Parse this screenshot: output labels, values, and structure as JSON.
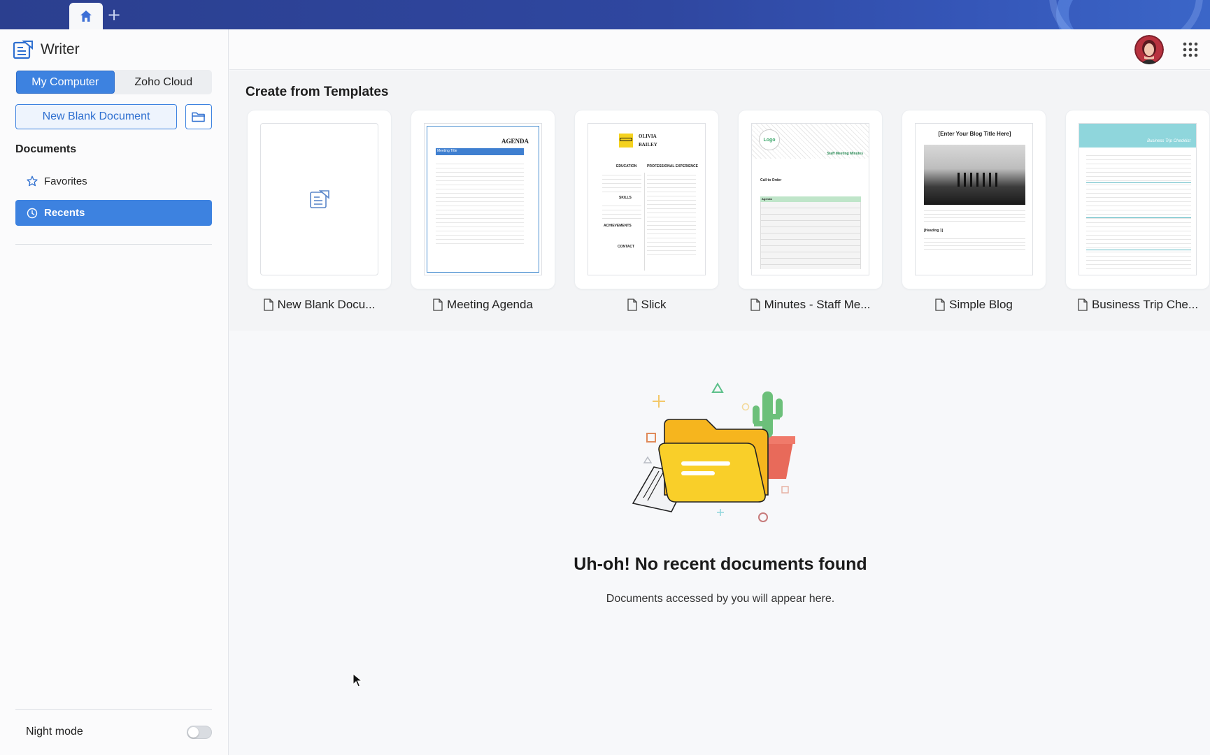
{
  "app": {
    "name": "Writer"
  },
  "tabs": [
    {
      "icon": "home-icon"
    },
    {
      "icon": "plus-icon"
    }
  ],
  "sidebar": {
    "source_tabs": [
      "My Computer",
      "Zoho Cloud"
    ],
    "active_source": "My Computer",
    "new_blank_label": "New Blank Document",
    "section_title": "Documents",
    "nav": [
      {
        "label": "Favorites",
        "icon": "star-icon",
        "active": false
      },
      {
        "label": "Recents",
        "icon": "clock-icon",
        "active": true
      }
    ],
    "night_mode_label": "Night mode",
    "night_mode_on": false
  },
  "templates": {
    "title": "Create from Templates",
    "items": [
      {
        "label": "New Blank Docu..."
      },
      {
        "label": "Meeting Agenda",
        "preview_heading": "AGENDA",
        "preview_bar": "Meeting Title"
      },
      {
        "label": "Slick",
        "preview_name": "OLIVIA BAILEY",
        "preview_sections": [
          "EDUCATION",
          "PROFESSIONAL EXPERIENCE",
          "SKILLS",
          "ACHIEVEMENTS",
          "CONTACT"
        ]
      },
      {
        "label": "Minutes - Staff Me...",
        "preview_logo": "Logo",
        "preview_heading": "Staff Meeting Minutes",
        "preview_sub": "Call to Order",
        "preview_col": "Agenda"
      },
      {
        "label": "Simple Blog",
        "preview_heading": "[Enter Your Blog Title Here]",
        "preview_sub": "[Heading 1]"
      },
      {
        "label": "Business Trip Che...",
        "preview_heading": "Business Trip Checklist"
      }
    ]
  },
  "empty_state": {
    "title": "Uh-oh! No recent documents found",
    "subtitle": "Documents accessed by you will appear here."
  },
  "colors": {
    "accent": "#3d82e0",
    "header_gradient_start": "#2b3f8f",
    "folder_yellow": "#f7c21d"
  }
}
